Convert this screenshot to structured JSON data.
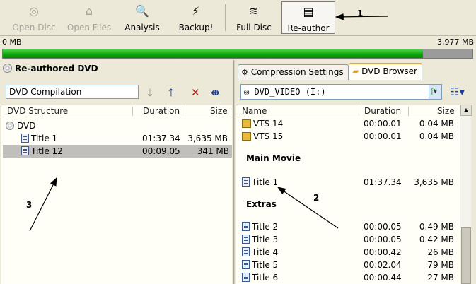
{
  "toolbar": {
    "buttons": [
      {
        "label": "Open Disc",
        "icon": "disc-icon",
        "glyph": "◎",
        "enabled": false
      },
      {
        "label": "Open Files",
        "icon": "open-folder-icon",
        "glyph": "⌂",
        "enabled": false
      },
      {
        "label": "Analysis",
        "icon": "magnifier-icon",
        "glyph": "🔍",
        "enabled": true
      },
      {
        "label": "Backup!",
        "icon": "backup-icon",
        "glyph": "⚡",
        "enabled": true
      },
      {
        "label": "Full Disc",
        "icon": "disc-stack-icon",
        "glyph": "≋",
        "enabled": true
      },
      {
        "label": "Re-author",
        "icon": "reauthor-document-icon",
        "glyph": "▤",
        "enabled": true,
        "active": true
      }
    ]
  },
  "capacity": {
    "min_label": "0 MB",
    "max_label": "3,977 MB",
    "fill_fraction": 0.895,
    "fill_color": "#0ba40b"
  },
  "left_panel": {
    "title": "Re-authored DVD",
    "name_value": "DVD Compilation",
    "columns": [
      "DVD Structure",
      "Duration",
      "Size"
    ],
    "root": "DVD",
    "rows": [
      {
        "name": "Title 1",
        "duration": "01:37.34",
        "size": "3,635 MB",
        "selected": false
      },
      {
        "name": "Title 12",
        "duration": "00:09.05",
        "size": "341 MB",
        "selected": true
      }
    ]
  },
  "right_panel": {
    "tabs": [
      {
        "label": "Compression Settings",
        "active": false
      },
      {
        "label": "DVD Browser",
        "active": true
      }
    ],
    "drive_value": "DVD_VIDEO (I:)",
    "columns": [
      "Name",
      "Duration",
      "Size"
    ],
    "vts_rows": [
      {
        "name": "VTS 14",
        "duration": "00:00.01",
        "size": "0.04 MB"
      },
      {
        "name": "VTS 15",
        "duration": "00:00.01",
        "size": "0.04 MB"
      }
    ],
    "main_movie_label": "Main Movie",
    "main_movie_rows": [
      {
        "name": "Title 1",
        "duration": "01:37.34",
        "size": "3,635 MB"
      }
    ],
    "extras_label": "Extras",
    "extras_rows": [
      {
        "name": "Title 2",
        "duration": "00:00.05",
        "size": "0.49 MB"
      },
      {
        "name": "Title 3",
        "duration": "00:00.05",
        "size": "0.42 MB"
      },
      {
        "name": "Title 4",
        "duration": "00:00.42",
        "size": "26 MB"
      },
      {
        "name": "Title 5",
        "duration": "00:02.04",
        "size": "79 MB"
      },
      {
        "name": "Title 6",
        "duration": "00:00.44",
        "size": "27 MB"
      }
    ]
  },
  "annotations": [
    "1",
    "2",
    "3"
  ]
}
